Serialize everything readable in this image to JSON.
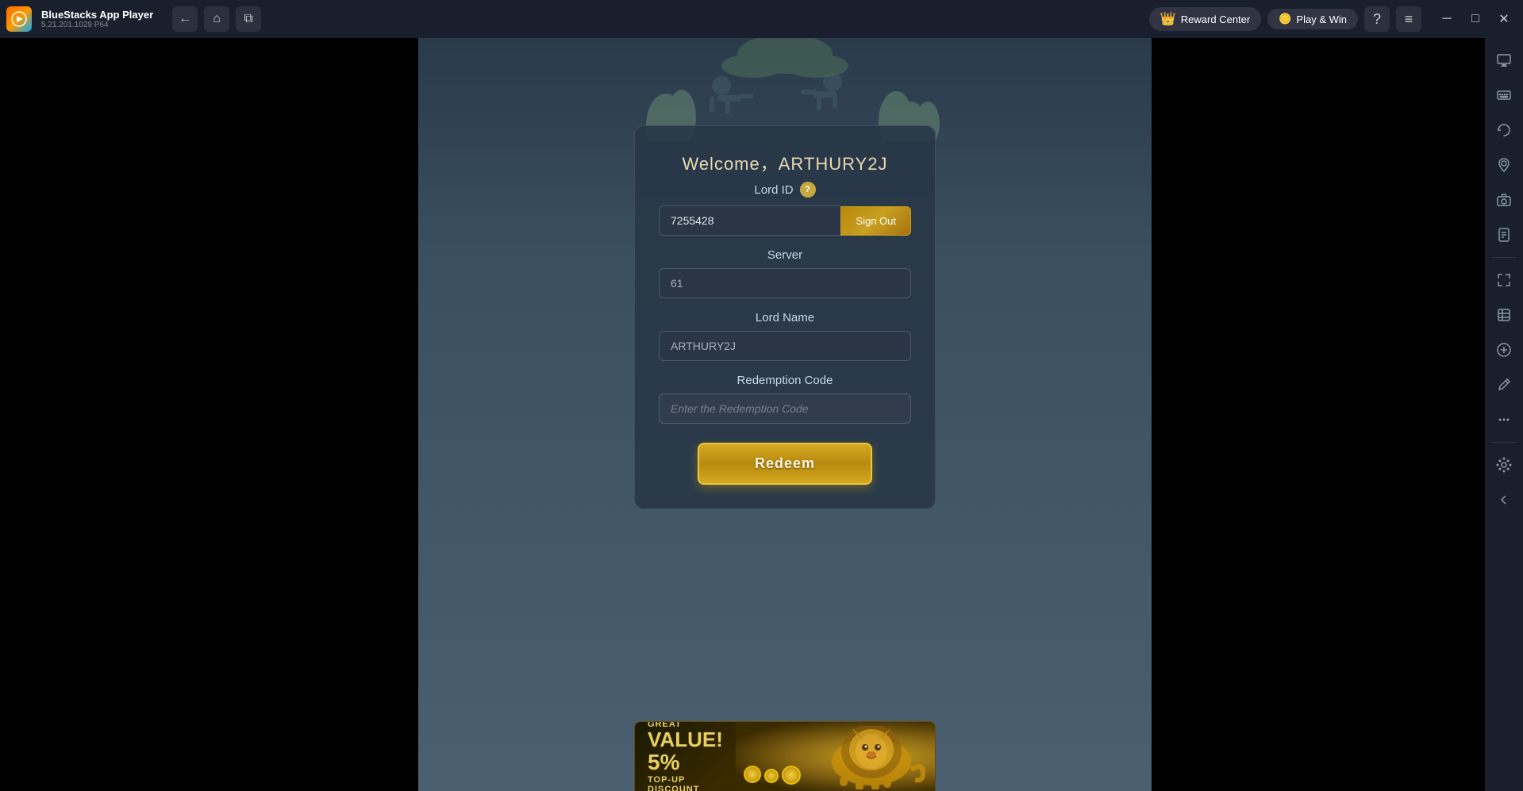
{
  "titlebar": {
    "app_name": "BlueStacks App Player",
    "app_version": "5.21.201.1029  P64",
    "nav": {
      "back_label": "←",
      "home_label": "⌂",
      "multi_label": "⧉"
    },
    "reward_center_label": "Reward Center",
    "play_win_label": "Play & Win",
    "help_label": "?",
    "hamburger_label": "≡",
    "minimize_label": "─",
    "maximize_label": "□",
    "close_label": "✕"
  },
  "game": {
    "welcome_text": "Welcome，ARTHURY2J",
    "lord_id_label": "Lord ID",
    "lord_id_value": "7255428",
    "sign_out_label": "Sign Out",
    "server_label": "Server",
    "server_value": "61",
    "lord_name_label": "Lord Name",
    "lord_name_value": "ARTHURY2J",
    "redemption_code_label": "Redemption Code",
    "redemption_code_placeholder": "Enter the Redemption Code",
    "redeem_label": "Redeem"
  },
  "banner": {
    "great_value_label": "GREAT",
    "value_label": "VALUE!",
    "percent_label": "5%",
    "topup_label": "TOP-UP",
    "discount_label": "DISCOUNT"
  },
  "sidebar": {
    "icons": [
      {
        "name": "screen-icon",
        "symbol": "⊡"
      },
      {
        "name": "keyboard-icon",
        "symbol": "⌨"
      },
      {
        "name": "rotate-icon",
        "symbol": "↻"
      },
      {
        "name": "location-icon",
        "symbol": "◎"
      },
      {
        "name": "camera-icon",
        "symbol": "📷"
      },
      {
        "name": "apk-icon",
        "symbol": "APK"
      },
      {
        "name": "resize-icon",
        "symbol": "⤢"
      },
      {
        "name": "media-icon",
        "symbol": "▤"
      },
      {
        "name": "game-icon",
        "symbol": "⊕"
      },
      {
        "name": "edit-icon",
        "symbol": "✎"
      },
      {
        "name": "more-icon",
        "symbol": "···"
      },
      {
        "name": "settings-icon",
        "symbol": "⚙"
      },
      {
        "name": "back-icon",
        "symbol": "↩"
      }
    ]
  }
}
